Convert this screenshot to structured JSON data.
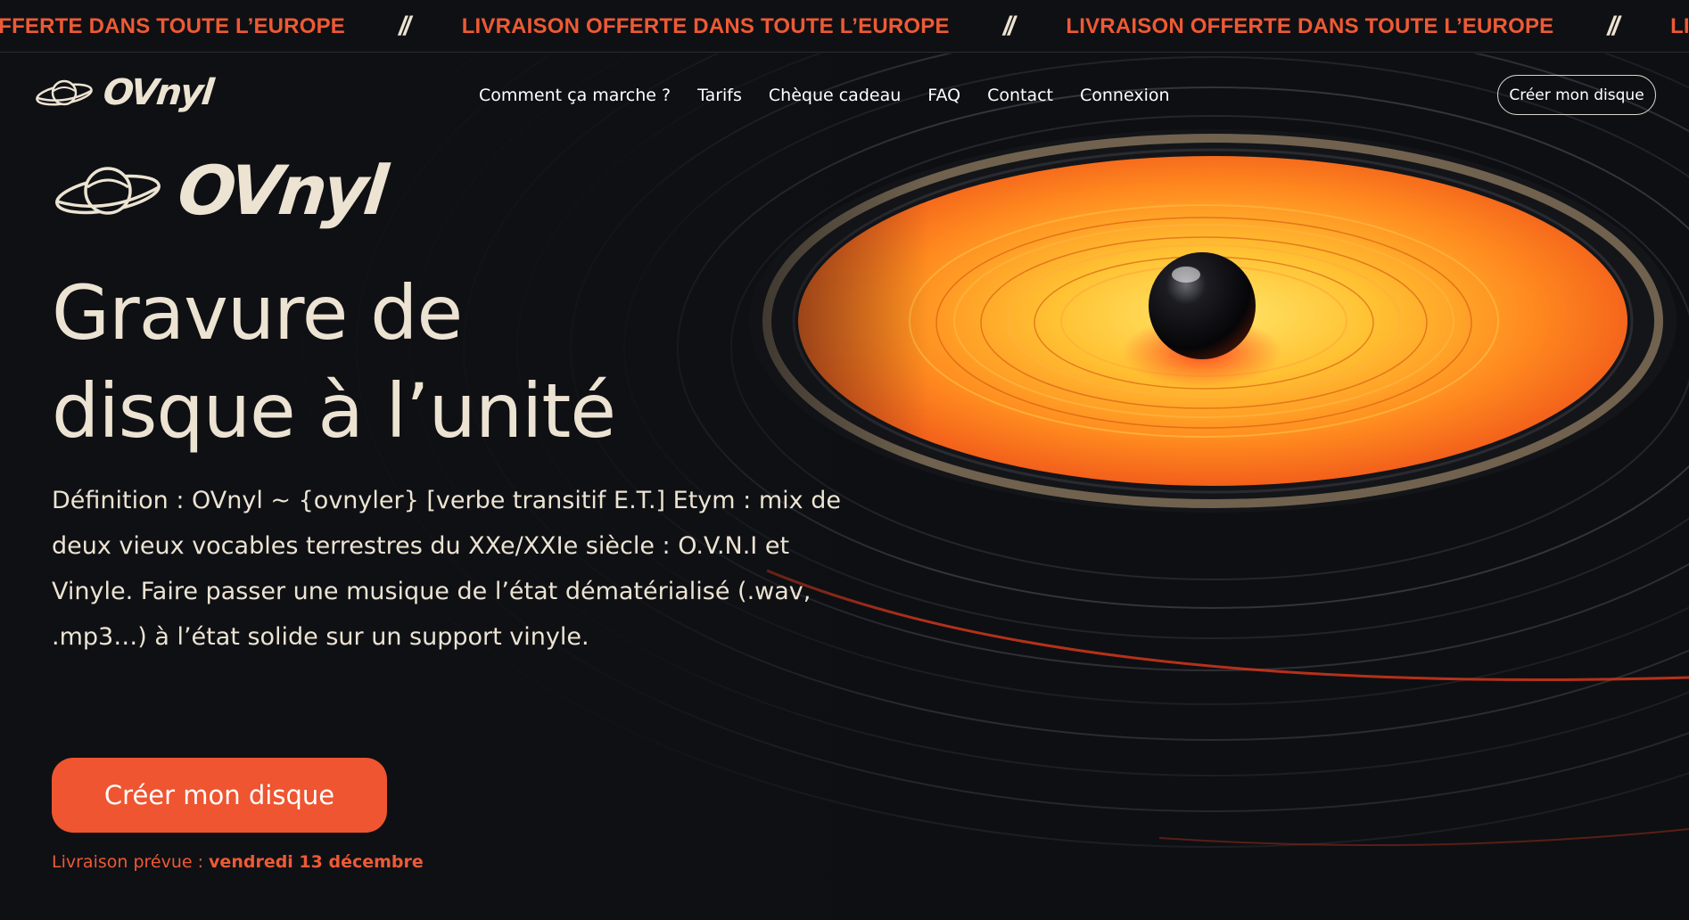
{
  "marquee": {
    "items": [
      "LIVRAISON OFFERTE DANS TOUTE L’EUROPE",
      "LIVRAISON OFFERTE DANS TOUTE L’EUROPE",
      "LIVRAISON OFFERTE DANS TOUTE L’EUROPE",
      "LIVRAISON OFFERTE DANS TOUTE L’EUROPE"
    ],
    "separator": "//"
  },
  "header": {
    "brand": "OVnyl",
    "nav": [
      "Comment ça marche ?",
      "Tarifs",
      "Chèque cadeau",
      "FAQ",
      "Contact",
      "Connexion"
    ],
    "cta_label": "Créer mon disque"
  },
  "hero": {
    "brand": "OVnyl",
    "title_line1": "Gravure de",
    "title_line2": "disque à l’unité",
    "description": "Définition : OVnyl ~ {ovnyler} [verbe transitif E.T.] Etym : mix de deux vieux vocables terrestres du XXe/XXIe siècle : O.V.N.I et Vinyle. Faire passer une musique de l’état dématérialisé (.wav, .mp3…) à l’état solide sur un support vinyle.",
    "cta_label": "Créer mon disque",
    "delivery_label": "Livraison prévue : ",
    "delivery_date": "vendredi 13 décembre"
  },
  "colors": {
    "accent": "#ee5530",
    "cream": "#ece3d2",
    "background": "#0f1014"
  }
}
